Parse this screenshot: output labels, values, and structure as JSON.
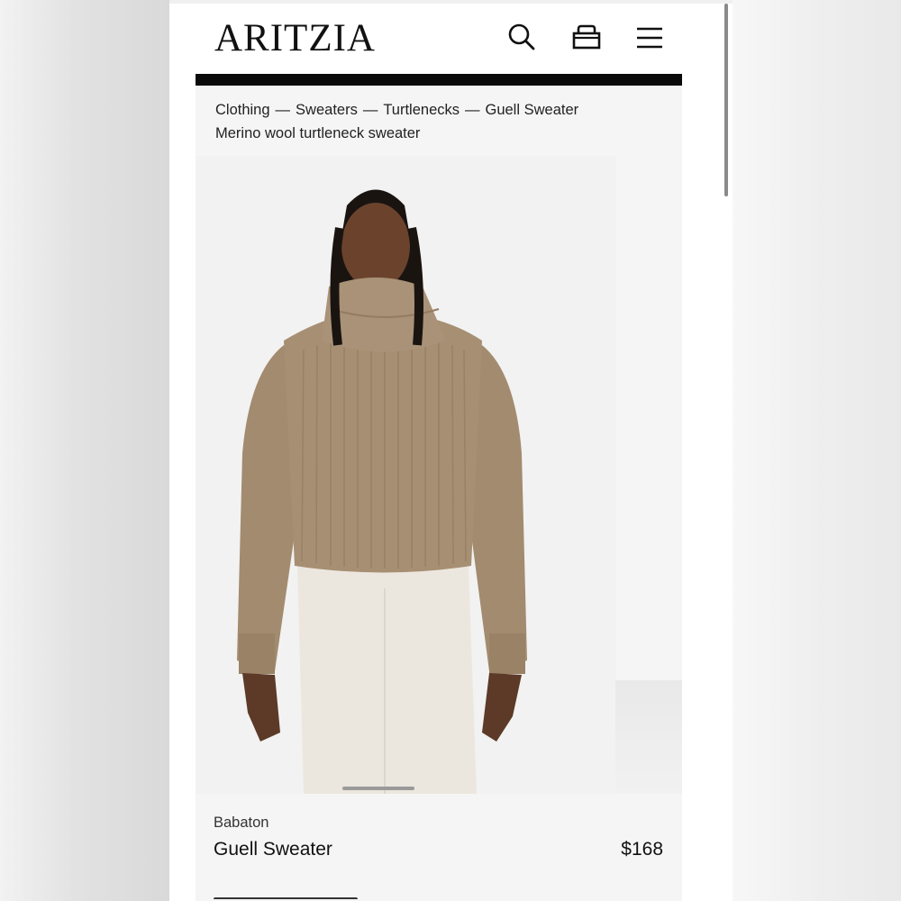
{
  "header": {
    "logo": "ARITZIA",
    "icons": [
      "search-icon",
      "bag-icon",
      "menu-icon"
    ]
  },
  "breadcrumb": {
    "items": [
      "Clothing",
      "Sweaters",
      "Turtlenecks",
      "Guell Sweater"
    ],
    "separator": "—"
  },
  "product": {
    "subtitle": "Merino wool turtleneck sweater",
    "brand": "Babaton",
    "name": "Guell Sweater",
    "price": "$168",
    "image": "model-in-camel-turtleneck-sweater"
  },
  "colors": {
    "accent_bar": "#0a0a0a",
    "sweater": "#a78f73",
    "pants": "#ece7de",
    "page": "#f5f5f5"
  }
}
